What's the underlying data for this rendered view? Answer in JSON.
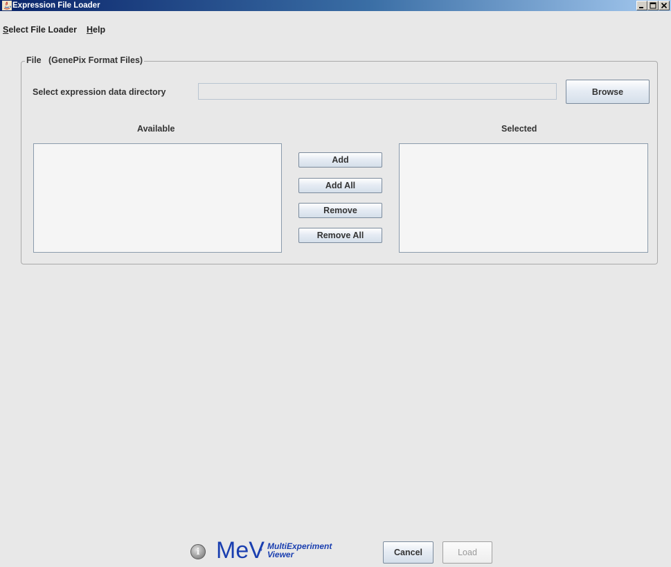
{
  "window": {
    "title": "Expression File Loader",
    "controls": [
      "minimize-icon",
      "maximize-icon",
      "close-icon"
    ]
  },
  "menubar": {
    "items": [
      {
        "mnemonic": "S",
        "rest": "elect File Loader"
      },
      {
        "mnemonic": "H",
        "rest": "elp"
      }
    ]
  },
  "file_group": {
    "legend": "File   (GenePix Format Files)",
    "dir_label": "Select expression data directory",
    "dir_value": "",
    "browse_label": "Browse",
    "available_header": "Available",
    "selected_header": "Selected",
    "available_items": [],
    "selected_items": [],
    "add_label": "Add",
    "add_all_label": "Add All",
    "remove_label": "Remove",
    "remove_all_label": "Remove All"
  },
  "footer": {
    "info_glyph": "i",
    "logo_text": "MeV",
    "logo_star": "*",
    "logo_sub_line1": "MultiExperiment",
    "logo_sub_line2": "Viewer",
    "cancel_label": "Cancel",
    "load_label": "Load"
  },
  "colors": {
    "titlebar_start": "#0a246a",
    "titlebar_end": "#a6caf0",
    "window_bg": "#e8e8e8",
    "logo_blue": "#1a3fb0"
  }
}
